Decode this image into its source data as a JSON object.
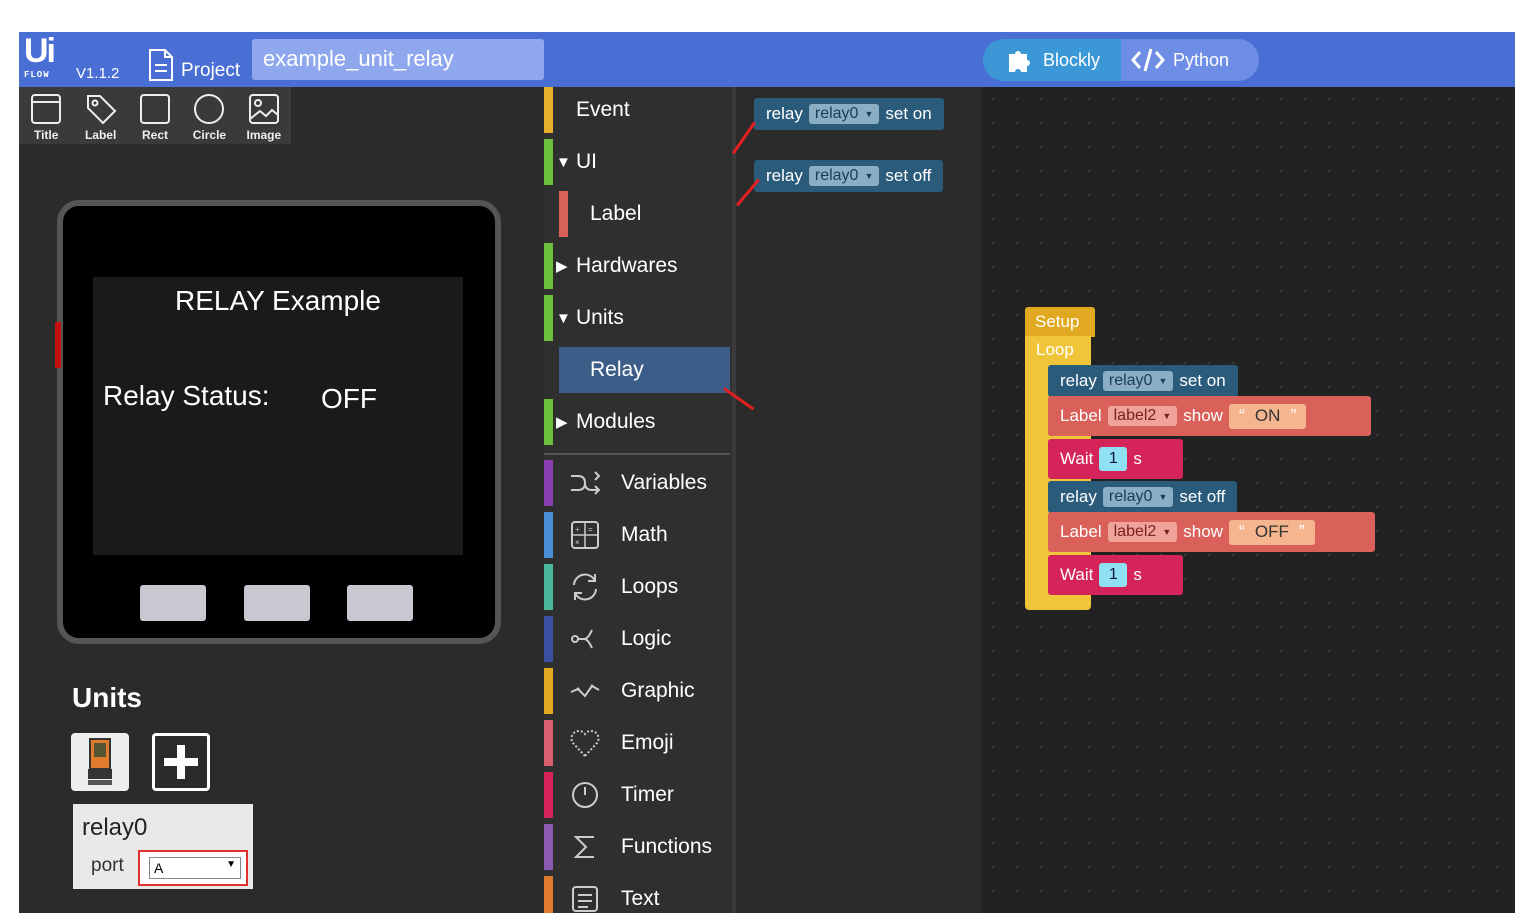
{
  "app": {
    "version": "V1.1.2",
    "project_label": "Project",
    "project_name": "example_unit_relay",
    "modes": [
      {
        "label": "Blockly",
        "active": true
      },
      {
        "label": "Python",
        "active": false
      }
    ]
  },
  "tools": [
    "Title",
    "Label",
    "Rect",
    "Circle",
    "Image"
  ],
  "screen": {
    "title": "RELAY Example",
    "status_label": "Relay Status:",
    "status_value": "OFF"
  },
  "units_panel": {
    "heading": "Units",
    "unit_name": "relay0",
    "port_label": "port",
    "port_value": "A"
  },
  "categories": [
    {
      "label": "Event",
      "color": "#e8b12c"
    },
    {
      "label": "UI",
      "color": "#6bc23a",
      "prefix": "▼"
    },
    {
      "label": "Label",
      "color": "#d9615a"
    },
    {
      "label": "Hardwares",
      "color": "#6bc23a",
      "prefix": "▶"
    },
    {
      "label": "Units",
      "color": "#6bc23a",
      "prefix": "▼"
    },
    {
      "label": "Relay",
      "color": "#3c5d88"
    },
    {
      "label": "Modules",
      "color": "#6bc23a",
      "prefix": "▶"
    },
    {
      "label": "Variables",
      "color": "#8a3fb0"
    },
    {
      "label": "Math",
      "color": "#4a90d9"
    },
    {
      "label": "Loops",
      "color": "#4ab89a"
    },
    {
      "label": "Logic",
      "color": "#3a4fa0"
    },
    {
      "label": "Graphic",
      "color": "#e0a920"
    },
    {
      "label": "Emoji",
      "color": "#d9616f"
    },
    {
      "label": "Timer",
      "color": "#d4245a"
    },
    {
      "label": "Functions",
      "color": "#8a5bb0"
    },
    {
      "label": "Text",
      "color": "#e07a2c"
    }
  ],
  "flyout_blocks": [
    {
      "prefix": "relay",
      "unit": "relay0",
      "action": "set on"
    },
    {
      "prefix": "relay",
      "unit": "relay0",
      "action": "set off"
    }
  ],
  "workspace": {
    "setup_label": "Setup",
    "loop_label": "Loop",
    "blocks": {
      "relay_on": {
        "prefix": "relay",
        "unit": "relay0",
        "action": "set on"
      },
      "label_on": {
        "prefix": "Label",
        "target": "label2",
        "verb": "show",
        "text": "ON"
      },
      "wait1": {
        "prefix": "Wait",
        "value": "1",
        "unit": "s"
      },
      "relay_off": {
        "prefix": "relay",
        "unit": "relay0",
        "action": "set off"
      },
      "label_off": {
        "prefix": "Label",
        "target": "label2",
        "verb": "show",
        "text": "OFF"
      },
      "wait2": {
        "prefix": "Wait",
        "value": "1",
        "unit": "s"
      }
    }
  }
}
